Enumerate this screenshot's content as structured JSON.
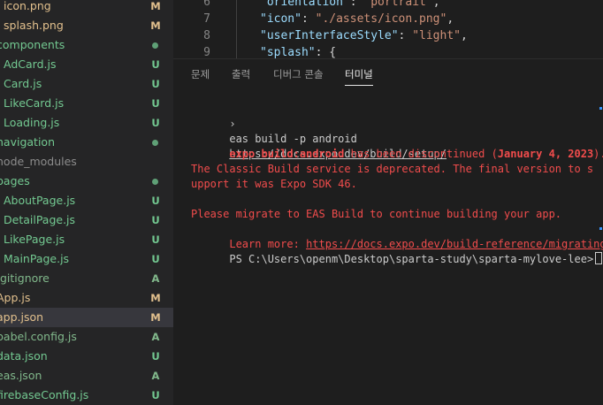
{
  "explorer": {
    "items": [
      {
        "name": "icon.png",
        "badge": "M",
        "badge_color": "#e2c08d",
        "name_color": "#e2c08d",
        "indent": 4
      },
      {
        "name": "splash.png",
        "badge": "M",
        "badge_color": "#e2c08d",
        "name_color": "#e2c08d",
        "indent": 4
      },
      {
        "name": "components",
        "badge": "dot",
        "badge_color": "#73c991",
        "name_color": "#73c991",
        "indent": 0
      },
      {
        "name": "AdCard.js",
        "badge": "U",
        "badge_color": "#73c991",
        "name_color": "#73c991",
        "indent": 4
      },
      {
        "name": "Card.js",
        "badge": "U",
        "badge_color": "#73c991",
        "name_color": "#73c991",
        "indent": 4
      },
      {
        "name": "LikeCard.js",
        "badge": "U",
        "badge_color": "#73c991",
        "name_color": "#73c991",
        "indent": 4
      },
      {
        "name": "Loading.js",
        "badge": "U",
        "badge_color": "#73c991",
        "name_color": "#73c991",
        "indent": 4
      },
      {
        "name": "navigation",
        "badge": "dot",
        "badge_color": "#73c991",
        "name_color": "#73c991",
        "indent": 0
      },
      {
        "name": "node_modules",
        "badge": "",
        "badge_color": "",
        "name_color": "#8c8c8c",
        "indent": 0
      },
      {
        "name": "pages",
        "badge": "dot",
        "badge_color": "#73c991",
        "name_color": "#73c991",
        "indent": 0
      },
      {
        "name": "AboutPage.js",
        "badge": "U",
        "badge_color": "#73c991",
        "name_color": "#73c991",
        "indent": 4
      },
      {
        "name": "DetailPage.js",
        "badge": "U",
        "badge_color": "#73c991",
        "name_color": "#73c991",
        "indent": 4
      },
      {
        "name": "LikePage.js",
        "badge": "U",
        "badge_color": "#73c991",
        "name_color": "#73c991",
        "indent": 4
      },
      {
        "name": "MainPage.js",
        "badge": "U",
        "badge_color": "#73c991",
        "name_color": "#73c991",
        "indent": 4
      },
      {
        "name": ".gitignore",
        "badge": "A",
        "badge_color": "#81b88b",
        "name_color": "#81b88b",
        "indent": 0
      },
      {
        "name": "App.js",
        "badge": "M",
        "badge_color": "#e2c08d",
        "name_color": "#e2c08d",
        "indent": 0
      },
      {
        "name": "app.json",
        "badge": "M",
        "badge_color": "#e2c08d",
        "name_color": "#e2c08d",
        "indent": 0
      },
      {
        "name": "babel.config.js",
        "badge": "A",
        "badge_color": "#81b88b",
        "name_color": "#81b88b",
        "indent": 0
      },
      {
        "name": "data.json",
        "badge": "U",
        "badge_color": "#73c991",
        "name_color": "#73c991",
        "indent": 0
      },
      {
        "name": "eas.json",
        "badge": "A",
        "badge_color": "#81b88b",
        "name_color": "#81b88b",
        "indent": 0
      },
      {
        "name": "firebaseConfig.js",
        "badge": "U",
        "badge_color": "#73c991",
        "name_color": "#73c991",
        "indent": 0
      }
    ],
    "selected_item": "app.json"
  },
  "editor": {
    "lines": [
      {
        "number": "6",
        "key": "\"orientation\"",
        "colon": ": ",
        "value": "\"portrait\"",
        "tail": ","
      },
      {
        "number": "7",
        "key": "\"icon\"",
        "colon": ": ",
        "value": "\"./assets/icon.png\"",
        "tail": ","
      },
      {
        "number": "8",
        "key": "\"userInterfaceStyle\"",
        "colon": ": ",
        "value": "\"light\"",
        "tail": ","
      },
      {
        "number": "9",
        "key": "\"splash\"",
        "colon": ": ",
        "value": "",
        "tail": "{"
      }
    ],
    "key_color": "#9cdcfe",
    "string_color": "#ce9178",
    "punct_color": "#d4d4d4"
  },
  "panel": {
    "tabs": [
      {
        "label": "문제",
        "active": false
      },
      {
        "label": "출력",
        "active": false
      },
      {
        "label": "디버그 콘솔",
        "active": false
      },
      {
        "label": "터미널",
        "active": true
      }
    ]
  },
  "terminal": {
    "command_prompt": "›",
    "command": "eas build -p android",
    "command_url": "https://docs.expo.dev/build/setup/",
    "discontinued": {
      "cmd": "expo build:android",
      "text1": " has been discontinued (",
      "date": "January 4, 2023",
      "text2": ")."
    },
    "classic_line1": "The Classic Build service is deprecated. The final version to s",
    "classic_line2": "upport it was Expo SDK 46.",
    "migrate_line": "Please migrate to EAS Build to continue building your app.",
    "learn_more_label": "Learn more: ",
    "learn_more_url": "https://docs.expo.dev/build-reference/migrating/",
    "ps_prompt": "PS C:\\Users\\openm\\Desktop\\sparta-study\\sparta-mylove-lee>"
  }
}
